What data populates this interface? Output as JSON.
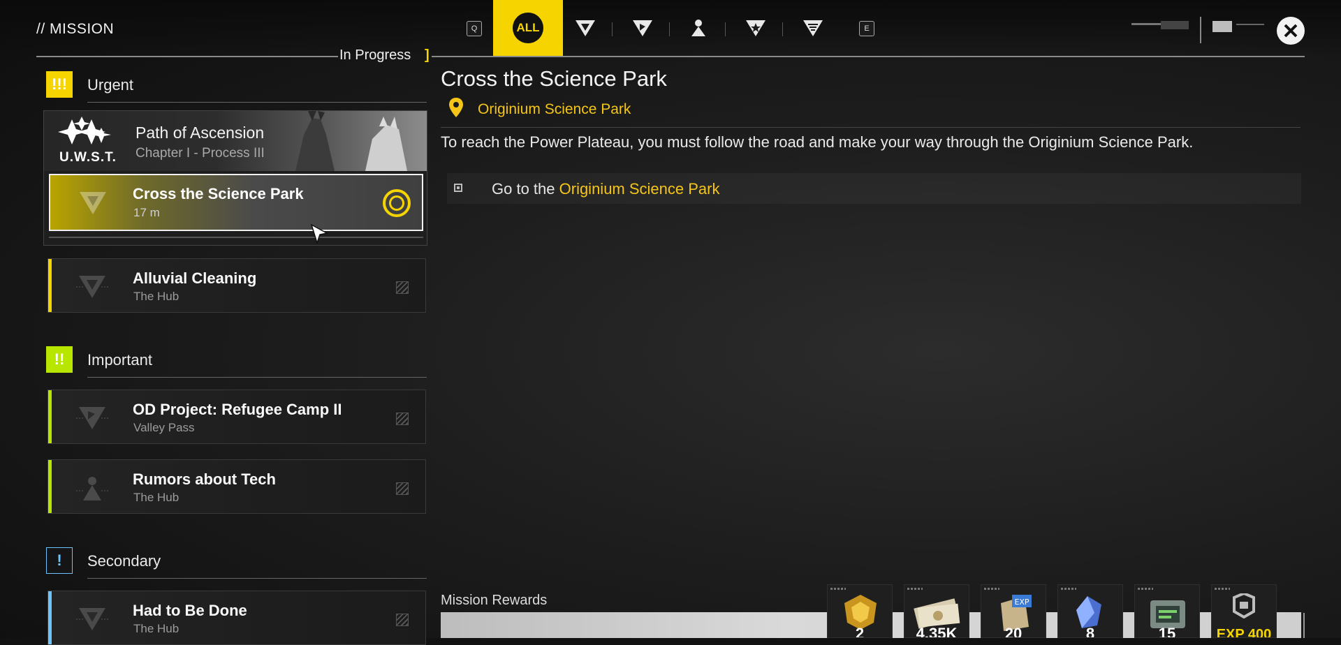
{
  "header": {
    "title": "// MISSION",
    "status": "In Progress",
    "status_bracket": "]"
  },
  "tabs": {
    "left_key": "Q",
    "right_key": "E",
    "items": [
      {
        "label": "ALL",
        "icon": "all-icon",
        "selected": true
      },
      {
        "label": "",
        "icon": "triangle-emblem-icon"
      },
      {
        "label": "",
        "icon": "chevron-emblem-icon"
      },
      {
        "label": "",
        "icon": "person-emblem-icon"
      },
      {
        "label": "",
        "icon": "star-emblem-icon"
      },
      {
        "label": "",
        "icon": "bars-emblem-icon"
      }
    ]
  },
  "sections": {
    "urgent": {
      "badge": "!!!",
      "label": "Urgent",
      "color": "#f5d400"
    },
    "important": {
      "badge": "!!",
      "label": "Important",
      "color": "#b9e600"
    },
    "secondary": {
      "badge": "!",
      "label": "Secondary",
      "color": "#6cc5ff"
    }
  },
  "ascension": {
    "logo_text": "U.W.S.T.",
    "title": "Path of Ascension",
    "subtitle": "Chapter I - Process III",
    "selected": {
      "name": "Cross the Science Park",
      "distance": "17 m"
    }
  },
  "missions": {
    "urgent": [
      {
        "name": "Alluvial Cleaning",
        "location": "The Hub"
      }
    ],
    "important": [
      {
        "name": "OD Project: Refugee Camp II",
        "location": "Valley Pass"
      },
      {
        "name": "Rumors about Tech",
        "location": "The Hub"
      }
    ],
    "secondary": [
      {
        "name": "Had to Be Done",
        "location": "The Hub"
      }
    ]
  },
  "detail": {
    "title": "Cross the Science Park",
    "location": "Originium Science Park",
    "description": "To reach the Power Plateau, you must follow the road and make your way through the Originium Science Park.",
    "objective_prefix": "Go to the ",
    "objective_highlight": "Originium Science Park"
  },
  "rewards": {
    "label": "Mission Rewards",
    "items": [
      {
        "icon": "gold-crest-icon",
        "count": "2"
      },
      {
        "icon": "money-bills-icon",
        "count": "4.35K"
      },
      {
        "icon": "exp-book-icon",
        "count": "20"
      },
      {
        "icon": "blue-crystal-icon",
        "count": "8"
      },
      {
        "icon": "green-device-icon",
        "count": "15"
      },
      {
        "icon": "exp-token-icon",
        "count": "EXP 400"
      }
    ]
  },
  "colors": {
    "accent": "#f5d400",
    "highlight_text": "#f5c518",
    "urgent": "#f5d400",
    "important": "#b9e600",
    "secondary": "#6cc5ff"
  }
}
